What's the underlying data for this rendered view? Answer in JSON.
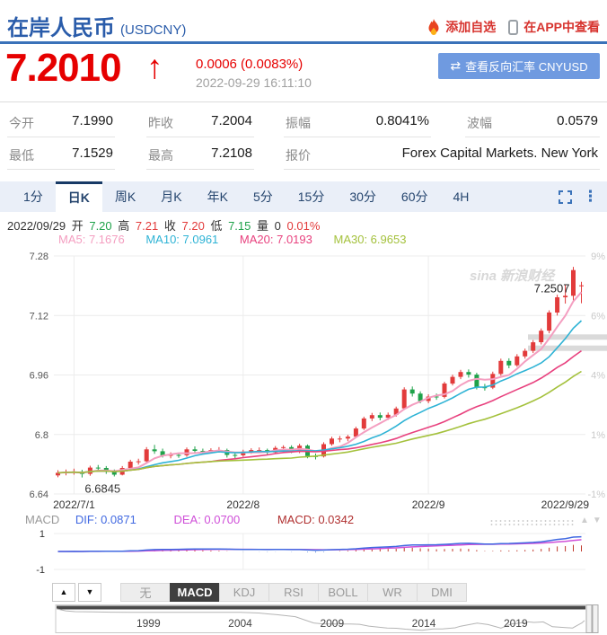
{
  "header": {
    "title": "在岸人民币",
    "symbol": "(USDCNY)",
    "add_watchlist": "添加自选",
    "view_in_app": "在APP中查看"
  },
  "quote": {
    "price": "7.2010",
    "change": "0.0006 (0.0083%)",
    "timestamp": "2022-09-29 16:11:10",
    "reverse_button": "查看反向汇率 CNYUSD"
  },
  "icons": {
    "up_arrow": "↑",
    "swap": "⇄",
    "kebab": "⋮",
    "tri_up": "▲",
    "tri_down": "▼"
  },
  "stats": {
    "rows": [
      [
        {
          "label": "今开",
          "value": "7.1990"
        },
        {
          "label": "昨收",
          "value": "7.2004"
        },
        {
          "label": "振幅",
          "value": "0.8041%"
        },
        {
          "label": "波幅",
          "value": "0.0579"
        }
      ],
      [
        {
          "label": "最低",
          "value": "7.1529"
        },
        {
          "label": "最高",
          "value": "7.2108"
        },
        {
          "label": "报价",
          "value": "Forex Capital Markets. New York"
        }
      ]
    ]
  },
  "period_tabs": {
    "items": [
      "1分",
      "日K",
      "周K",
      "月K",
      "年K",
      "5分",
      "15分",
      "30分",
      "60分",
      "4H"
    ],
    "active": "日K"
  },
  "ohlc_info": {
    "date": "2022/09/29",
    "open_label": "开",
    "open": "7.20",
    "high_label": "高",
    "high": "7.21",
    "close_label": "收",
    "close": "7.20",
    "low_label": "低",
    "low": "7.15",
    "volume_label": "量",
    "volume": "0",
    "change_pct": "0.01%"
  },
  "ma_legend": [
    {
      "label": "MA5: 7.1676"
    },
    {
      "label": "MA10: 7.0961"
    },
    {
      "label": "MA20: 7.0193"
    },
    {
      "label": "MA30: 6.9653"
    }
  ],
  "macd_legend": {
    "title": "MACD",
    "dif": "DIF: 0.0871",
    "dea": "DEA: 0.0700",
    "macd": "MACD: 0.0342"
  },
  "indicator_tabs": {
    "items": [
      "无",
      "MACD",
      "KDJ",
      "RSI",
      "BOLL",
      "WR",
      "DMI"
    ],
    "active": "MACD"
  },
  "watermark": "sina 新浪财经",
  "colors": {
    "title_blue": "#2a5caa",
    "red": "#e60000",
    "link_red": "#d7332e",
    "button_bg": "#6f9ae0",
    "up": "#e23b3b",
    "down": "#1fa24a",
    "ma5": "#f49ec0",
    "ma10": "#2eb3d5",
    "ma20": "#e8417e",
    "ma30": "#a4c13c",
    "dif": "#4169e1",
    "dea": "#cf4fd8",
    "macd_value": "#b03030",
    "macd_bar_pos": "#c0392b",
    "macd_bar_neg": "#5b8dd8",
    "gray_text": "#999999"
  },
  "chart_data": [
    {
      "type": "candlestick",
      "title": "USDCNY 日K",
      "ylim": [
        6.64,
        7.28
      ],
      "y_ticks": [
        "7.28",
        "7.12",
        "6.96",
        "6.8",
        "6.64"
      ],
      "y_ticks_right": [
        "9%",
        "6%",
        "4%",
        "1%",
        "-1%"
      ],
      "x_ticks": [
        {
          "label": "2022/7/1",
          "index": 2
        },
        {
          "label": "2022/8",
          "index": 23
        },
        {
          "label": "2022/9",
          "index": 46
        },
        {
          "label": "2022/9/29",
          "index": 65
        }
      ],
      "annotations": {
        "high": {
          "label": "7.2507",
          "index": 64
        },
        "low": {
          "label": "6.6845",
          "index": 3
        }
      },
      "ma_periods": [
        5,
        10,
        20,
        30
      ],
      "highlight_bands": [
        7.062,
        7.032
      ],
      "candles": [
        [
          "2022-06-29",
          6.69,
          6.704,
          6.685,
          6.697
        ],
        [
          "2022-06-30",
          6.697,
          6.706,
          6.69,
          6.699
        ],
        [
          "2022-07-01",
          6.699,
          6.708,
          6.692,
          6.7
        ],
        [
          "2022-07-04",
          6.7,
          6.705,
          6.6845,
          6.694
        ],
        [
          "2022-07-05",
          6.694,
          6.716,
          6.689,
          6.711
        ],
        [
          "2022-07-06",
          6.711,
          6.718,
          6.703,
          6.71
        ],
        [
          "2022-07-07",
          6.71,
          6.715,
          6.694,
          6.7
        ],
        [
          "2022-07-08",
          6.7,
          6.706,
          6.687,
          6.692
        ],
        [
          "2022-07-11",
          6.692,
          6.715,
          6.69,
          6.71
        ],
        [
          "2022-07-12",
          6.71,
          6.732,
          6.706,
          6.727
        ],
        [
          "2022-07-13",
          6.727,
          6.735,
          6.719,
          6.728
        ],
        [
          "2022-07-14",
          6.728,
          6.766,
          6.724,
          6.76
        ],
        [
          "2022-07-15",
          6.76,
          6.772,
          6.748,
          6.755
        ],
        [
          "2022-07-18",
          6.755,
          6.762,
          6.738,
          6.744
        ],
        [
          "2022-07-19",
          6.744,
          6.752,
          6.736,
          6.745
        ],
        [
          "2022-07-20",
          6.745,
          6.751,
          6.737,
          6.744
        ],
        [
          "2022-07-21",
          6.744,
          6.765,
          6.74,
          6.76
        ],
        [
          "2022-07-22",
          6.76,
          6.768,
          6.75,
          6.756
        ],
        [
          "2022-07-25",
          6.756,
          6.762,
          6.748,
          6.754
        ],
        [
          "2022-07-26",
          6.754,
          6.763,
          6.749,
          6.758
        ],
        [
          "2022-07-27",
          6.758,
          6.766,
          6.751,
          6.758
        ],
        [
          "2022-07-28",
          6.758,
          6.762,
          6.738,
          6.745
        ],
        [
          "2022-07-29",
          6.745,
          6.752,
          6.736,
          6.744
        ],
        [
          "2022-08-01",
          6.744,
          6.759,
          6.74,
          6.754
        ],
        [
          "2022-08-02",
          6.754,
          6.763,
          6.748,
          6.758
        ],
        [
          "2022-08-03",
          6.758,
          6.765,
          6.75,
          6.758
        ],
        [
          "2022-08-04",
          6.758,
          6.762,
          6.744,
          6.752
        ],
        [
          "2022-08-05",
          6.752,
          6.769,
          6.748,
          6.764
        ],
        [
          "2022-08-08",
          6.764,
          6.771,
          6.756,
          6.766
        ],
        [
          "2022-08-09",
          6.766,
          6.771,
          6.75,
          6.756
        ],
        [
          "2022-08-10",
          6.756,
          6.775,
          6.75,
          6.77
        ],
        [
          "2022-08-11",
          6.77,
          6.773,
          6.736,
          6.742
        ],
        [
          "2022-08-12",
          6.742,
          6.749,
          6.733,
          6.741
        ],
        [
          "2022-08-15",
          6.741,
          6.779,
          6.738,
          6.774
        ],
        [
          "2022-08-16",
          6.774,
          6.794,
          6.77,
          6.789
        ],
        [
          "2022-08-17",
          6.789,
          6.796,
          6.779,
          6.789
        ],
        [
          "2022-08-18",
          6.789,
          6.799,
          6.782,
          6.794
        ],
        [
          "2022-08-19",
          6.794,
          6.821,
          6.79,
          6.816
        ],
        [
          "2022-08-22",
          6.816,
          6.848,
          6.812,
          6.843
        ],
        [
          "2022-08-23",
          6.843,
          6.858,
          6.836,
          6.852
        ],
        [
          "2022-08-24",
          6.852,
          6.859,
          6.838,
          6.845
        ],
        [
          "2022-08-25",
          6.845,
          6.859,
          6.839,
          6.853
        ],
        [
          "2022-08-26",
          6.853,
          6.875,
          6.848,
          6.87
        ],
        [
          "2022-08-29",
          6.87,
          6.927,
          6.866,
          6.921
        ],
        [
          "2022-08-30",
          6.921,
          6.929,
          6.902,
          6.91
        ],
        [
          "2022-08-31",
          6.91,
          6.916,
          6.884,
          6.89
        ],
        [
          "2022-09-01",
          6.89,
          6.908,
          6.884,
          6.902
        ],
        [
          "2022-09-02",
          6.902,
          6.91,
          6.893,
          6.901
        ],
        [
          "2022-09-05",
          6.901,
          6.942,
          6.897,
          6.937
        ],
        [
          "2022-09-06",
          6.937,
          6.961,
          6.932,
          6.955
        ],
        [
          "2022-09-07",
          6.955,
          6.974,
          6.949,
          6.968
        ],
        [
          "2022-09-08",
          6.968,
          6.975,
          6.953,
          6.961
        ],
        [
          "2022-09-09",
          6.961,
          6.966,
          6.921,
          6.927
        ],
        [
          "2022-09-13",
          6.927,
          6.936,
          6.918,
          6.926
        ],
        [
          "2022-09-14",
          6.926,
          6.969,
          6.922,
          6.963
        ],
        [
          "2022-09-15",
          6.963,
          7.004,
          6.958,
          6.998
        ],
        [
          "2022-09-16",
          6.998,
          7.005,
          6.978,
          6.986
        ],
        [
          "2022-09-19",
          6.986,
          7.016,
          6.982,
          7.01
        ],
        [
          "2022-09-20",
          7.01,
          7.031,
          7.004,
          7.025
        ],
        [
          "2022-09-21",
          7.025,
          7.054,
          7.019,
          7.048
        ],
        [
          "2022-09-22",
          7.048,
          7.085,
          7.042,
          7.079
        ],
        [
          "2022-09-23",
          7.079,
          7.134,
          7.072,
          7.128
        ],
        [
          "2022-09-26",
          7.128,
          7.176,
          7.12,
          7.169
        ],
        [
          "2022-09-27",
          7.169,
          7.202,
          7.152,
          7.173
        ],
        [
          "2022-09-28",
          7.173,
          7.2507,
          7.16,
          7.242
        ],
        [
          "2022-09-29",
          7.199,
          7.2108,
          7.1529,
          7.201
        ]
      ]
    },
    {
      "type": "line",
      "name": "macd-panel",
      "y_axis_labels": [
        "1",
        "-1"
      ],
      "dif_last": 0.0871,
      "dea_last": 0.07,
      "macd_last": 0.0342
    },
    {
      "type": "area",
      "name": "history-navigator",
      "x_labels": [
        "1999",
        "2004",
        "2009",
        "2014",
        "2019"
      ],
      "x_range": [
        1994,
        2022.75
      ],
      "points": [
        [
          1994,
          8.7
        ],
        [
          1994.5,
          8.45
        ],
        [
          1995,
          8.35
        ],
        [
          1996,
          8.33
        ],
        [
          1997,
          8.29
        ],
        [
          1998,
          8.28
        ],
        [
          2000,
          8.28
        ],
        [
          2002,
          8.28
        ],
        [
          2004,
          8.28
        ],
        [
          2005,
          8.19
        ],
        [
          2005.5,
          8.07
        ],
        [
          2006,
          7.97
        ],
        [
          2007,
          7.73
        ],
        [
          2008,
          6.95
        ],
        [
          2008.5,
          6.84
        ],
        [
          2009,
          6.83
        ],
        [
          2010,
          6.82
        ],
        [
          2010.5,
          6.78
        ],
        [
          2011,
          6.56
        ],
        [
          2012,
          6.31
        ],
        [
          2012.5,
          6.29
        ],
        [
          2013,
          6.18
        ],
        [
          2013.9,
          6.05
        ],
        [
          2014.5,
          6.2
        ],
        [
          2015,
          6.21
        ],
        [
          2015.7,
          6.35
        ],
        [
          2016,
          6.55
        ],
        [
          2016.9,
          6.93
        ],
        [
          2017.5,
          6.75
        ],
        [
          2018.2,
          6.3
        ],
        [
          2018.8,
          6.85
        ],
        [
          2019,
          6.87
        ],
        [
          2019.7,
          7.08
        ],
        [
          2020,
          7.02
        ],
        [
          2020.5,
          7.08
        ],
        [
          2021,
          6.48
        ],
        [
          2021.8,
          6.36
        ],
        [
          2022.1,
          6.32
        ],
        [
          2022.4,
          6.7
        ],
        [
          2022.6,
          6.95
        ],
        [
          2022.75,
          7.25
        ]
      ]
    }
  ]
}
